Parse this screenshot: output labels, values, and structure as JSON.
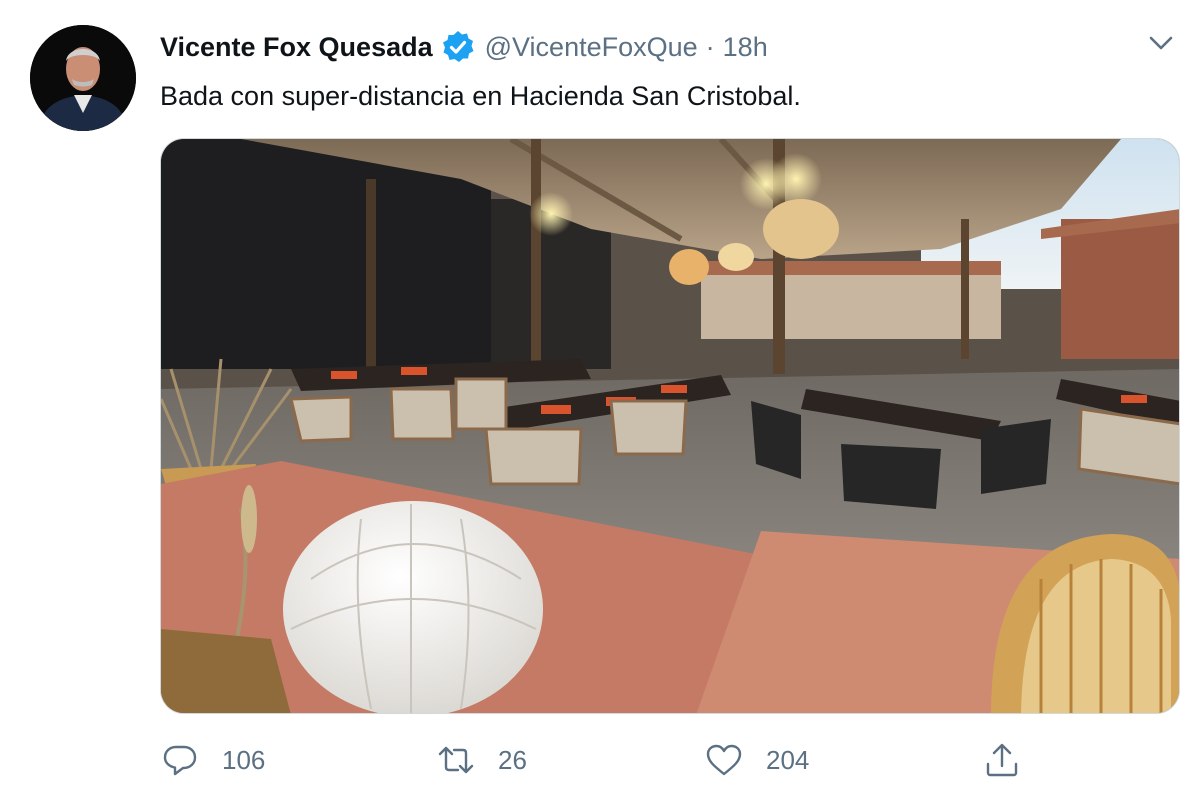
{
  "tweet": {
    "author_name": "Vicente Fox Quesada",
    "handle": "@VicenteFoxQue",
    "separator": "·",
    "timestamp": "18h",
    "text": "Bada con super-distancia en Hacienda San Cristobal."
  },
  "actions": {
    "reply_count": "106",
    "retweet_count": "26",
    "like_count": "204"
  },
  "icons": {
    "verified": "verified-badge-icon",
    "menu": "chevron-down-icon",
    "reply": "reply-icon",
    "retweet": "retweet-icon",
    "like": "heart-icon",
    "share": "share-icon"
  },
  "colors": {
    "text_primary": "#0f1419",
    "text_secondary": "#5b7083",
    "verified_blue": "#1da1f2"
  }
}
